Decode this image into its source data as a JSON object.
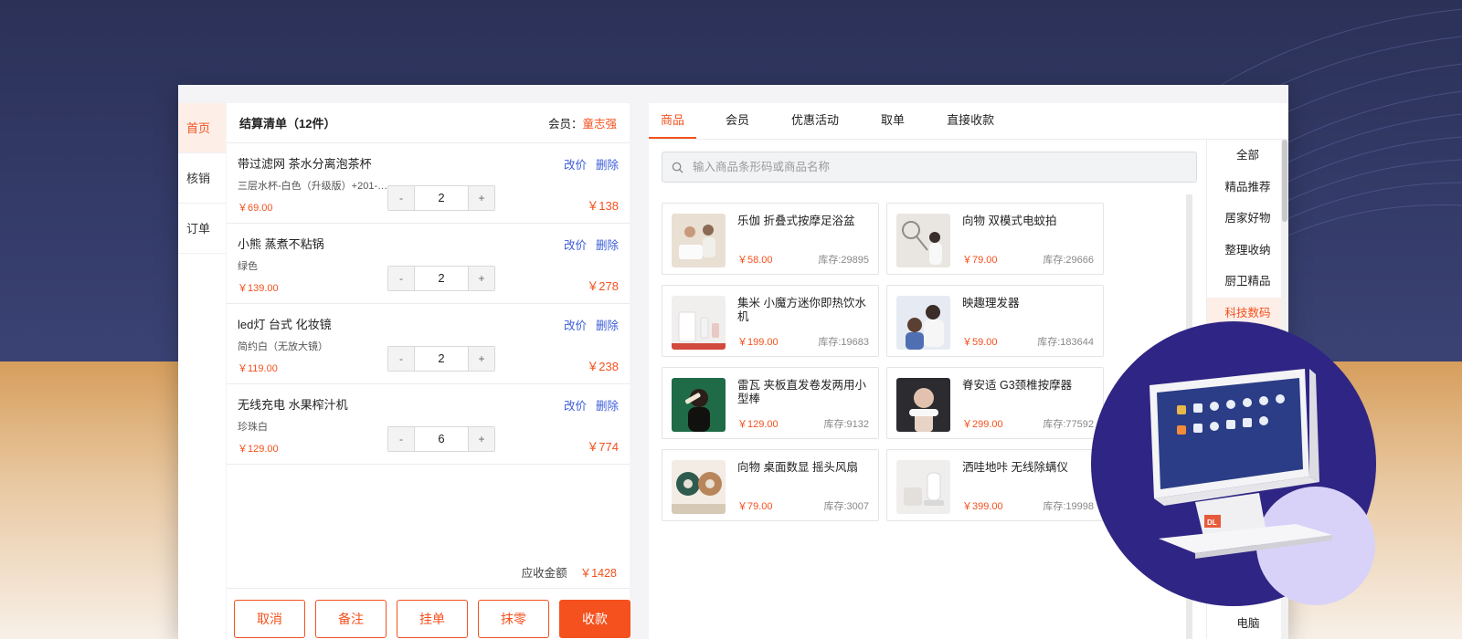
{
  "sidenav": {
    "items": [
      "首页",
      "核销",
      "订单"
    ]
  },
  "cart": {
    "title": "结算清单（12件）",
    "member_label": "会员：",
    "member_name": "童志强",
    "action_modify": "改价",
    "action_delete": "删除",
    "items": [
      {
        "name": "带过滤网 茶水分离泡茶杯",
        "spec": "三层水杯-白色（升级版）+201-3...",
        "unit_price": "￥69.00",
        "qty": "2",
        "total": "￥138"
      },
      {
        "name": "小熊 蒸煮不粘锅",
        "spec": "绿色",
        "unit_price": "￥139.00",
        "qty": "2",
        "total": "￥278"
      },
      {
        "name": "led灯 台式 化妆镜",
        "spec": "简约白（无放大镜）",
        "unit_price": "￥119.00",
        "qty": "2",
        "total": "￥238"
      },
      {
        "name": "无线充电 水果榨汁机",
        "spec": "珍珠白",
        "unit_price": "￥129.00",
        "qty": "6",
        "total": "￥774"
      }
    ],
    "stepper_minus": "-",
    "stepper_plus": "+",
    "amount_label": "应收金额",
    "amount_value": "￥1428",
    "buttons": [
      "取消",
      "备注",
      "挂单",
      "抹零",
      "收款"
    ]
  },
  "main": {
    "tabs": [
      "商品",
      "会员",
      "优惠活动",
      "取单",
      "直接收款"
    ],
    "search_placeholder": "输入商品条形码或商品名称",
    "products": [
      {
        "name": "乐伽 折叠式按摩足浴盆",
        "price": "￥58.00",
        "stock": "库存:29895"
      },
      {
        "name": "向物 双模式电蚊拍",
        "price": "￥79.00",
        "stock": "库存:29666"
      },
      {
        "name": "集米 小魔方迷你即热饮水机",
        "price": "￥199.00",
        "stock": "库存:19683"
      },
      {
        "name": "映趣理发器",
        "price": "￥59.00",
        "stock": "库存:183644"
      },
      {
        "name": "雷瓦 夹板直发卷发两用小型棒",
        "price": "￥129.00",
        "stock": "库存:9132"
      },
      {
        "name": "脊安适 G3颈椎按摩器",
        "price": "￥299.00",
        "stock": "库存:77592"
      },
      {
        "name": "向物 桌面数显 摇头风扇",
        "price": "￥79.00",
        "stock": "库存:3007"
      },
      {
        "name": "洒哇地咔 无线除螨仪",
        "price": "￥399.00",
        "stock": "库存:19998"
      }
    ],
    "categories": [
      "全部",
      "精品推荐",
      "居家好物",
      "整理收纳",
      "厨卫精品",
      "科技数码"
    ],
    "category_bottom": "电脑"
  },
  "device": {
    "logo": "DL"
  },
  "colors": {
    "accent": "#f4511e",
    "link": "#3b5cd9",
    "bg_top": "#2b3157",
    "bg_bottom": "#d69e5c",
    "circle": "#2f2584"
  },
  "icons": {
    "search": "search-icon"
  }
}
